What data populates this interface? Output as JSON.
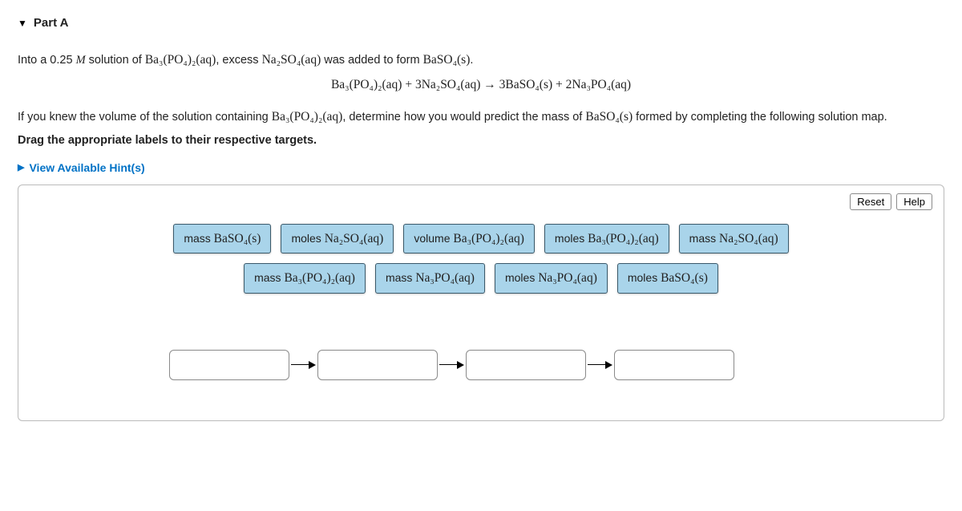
{
  "part": {
    "label": "Part A",
    "collapse_icon": "▼"
  },
  "prompt": {
    "line1_a": "Into a 0.25 ",
    "M": "M",
    "line1_b": " solution of ",
    "r1": "Ba₃(PO₄)₂(aq)",
    "line1_c": ", excess ",
    "r2": "Na₂SO₄(aq)",
    "line1_d": " was added to form ",
    "r3": "BaSO₄(s)",
    "line1_e": ".",
    "equation": "Ba₃(PO₄)₂(aq)  +  3Na₂SO₄(aq)  →  3BaSO₄(s)  +  2Na₃PO₄(aq)",
    "line2_a": "If you knew the volume of the solution containing ",
    "r4": "Ba₃(PO₄)₂(aq)",
    "line2_b": ", determine how you would predict the mass of ",
    "r5": "BaSO₄(s)",
    "line2_c": " formed by completing the following solution map.",
    "drag": "Drag the appropriate labels to their respective targets."
  },
  "hints": {
    "label": "View Available Hint(s)",
    "icon": "▶"
  },
  "buttons": {
    "reset": "Reset",
    "help": "Help"
  },
  "chips": {
    "row1": [
      {
        "pre": "mass ",
        "chem": "BaSO₄(s)"
      },
      {
        "pre": "moles ",
        "chem": "Na₂SO₄(aq)"
      },
      {
        "pre": "volume ",
        "chem": "Ba₃(PO₄)₂(aq)"
      },
      {
        "pre": "moles ",
        "chem": "Ba₃(PO₄)₂(aq)"
      },
      {
        "pre": "mass ",
        "chem": "Na₂SO₄(aq)"
      }
    ],
    "row2": [
      {
        "pre": "mass ",
        "chem": "Ba₃(PO₄)₂(aq)"
      },
      {
        "pre": "mass ",
        "chem": "Na₃PO₄(aq)"
      },
      {
        "pre": "moles ",
        "chem": "Na₃PO₄(aq)"
      },
      {
        "pre": "moles ",
        "chem": "BaSO₄(s)"
      }
    ]
  }
}
